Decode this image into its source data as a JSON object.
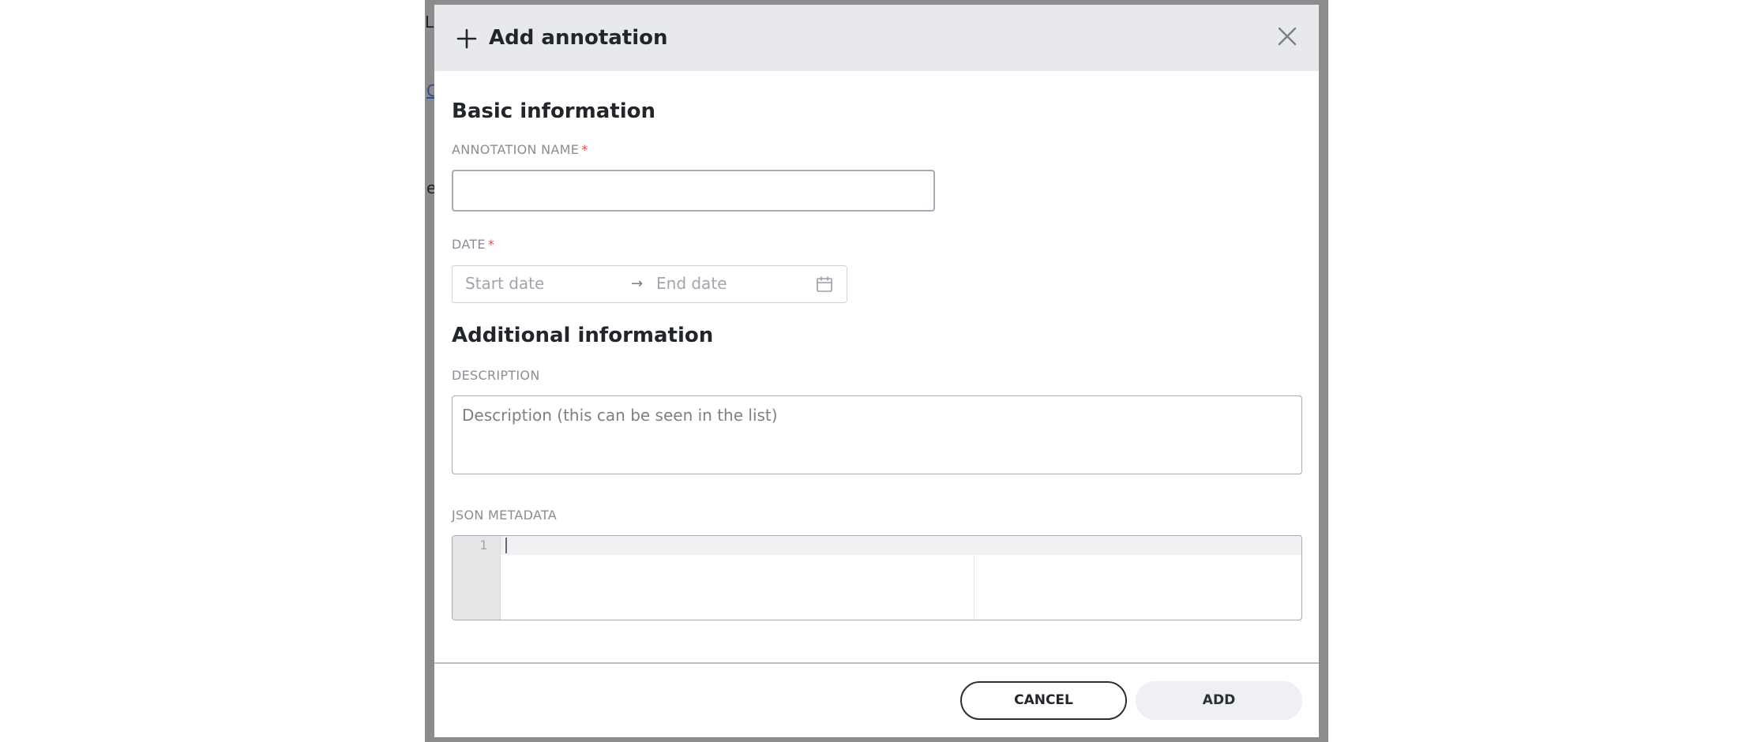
{
  "background": {
    "fragments": [
      "L",
      "C",
      "e"
    ]
  },
  "modal": {
    "title": "Add annotation",
    "close_icon": "close-icon",
    "basic_section": {
      "heading": "Basic information",
      "name_label": "ANNOTATION NAME",
      "name_value": "",
      "date_label": "DATE",
      "required_marker": "*",
      "start_placeholder": "Start date",
      "arrow": "→",
      "end_placeholder": "End date"
    },
    "additional_section": {
      "heading": "Additional information",
      "description_label": "DESCRIPTION",
      "description_placeholder": "Description (this can be seen in the list)",
      "json_label": "JSON METADATA",
      "line_number": "1"
    },
    "footer": {
      "cancel_label": "CANCEL",
      "add_label": "ADD"
    }
  },
  "colors": {
    "header_bg": "#e8e9ec",
    "backdrop": "#8c8c8c",
    "required": "#e5484d",
    "add_button_bg": "#eef0f3"
  }
}
